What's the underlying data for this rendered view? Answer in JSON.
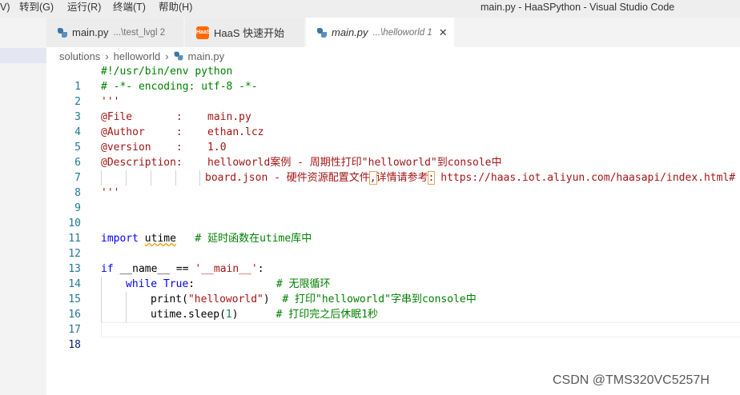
{
  "menubar": {
    "partial_left": "V)",
    "goto": "转到(G)",
    "run": "运行(R)",
    "terminal": "终端(T)",
    "help": "帮助(H)"
  },
  "window_title": "main.py - HaaSPython - Visual Studio Code",
  "tabs": [
    {
      "name": "main.py",
      "desc": "...\\test_lvgl 2",
      "icon": "python-icon"
    },
    {
      "name": "HaaS 快速开始",
      "desc": "",
      "icon": "haas-icon"
    },
    {
      "name": "main.py",
      "desc": "...\\helloworld 1",
      "icon": "python-icon",
      "active": true
    }
  ],
  "tab_close_glyph": "✕",
  "haas_icon_text": "HaaS",
  "breadcrumb": {
    "sep": "›",
    "items": [
      "solutions",
      "helloworld",
      "main.py"
    ]
  },
  "line_numbers": [
    "1",
    "2",
    "3",
    "4",
    "5",
    "6",
    "7",
    "8",
    "9",
    "10",
    "11",
    "12",
    "13",
    "14",
    "15",
    "16",
    "17",
    "18"
  ],
  "code": {
    "l1": "#!/usr/bin/env python",
    "l2": "# -*- encoding: utf-8 -*-",
    "l3": "'''",
    "l4": "@File       :    main.py",
    "l5": "@Author     :    ethan.lcz",
    "l6": "@version    :    1.0",
    "l7": "@Description:    helloworld案例 - 周期性打印\"helloworld\"到console中",
    "l8a": "board.json - 硬件资源配置文件",
    "l8b": ",",
    "l8c": "详情请参考",
    "l8d": ":",
    "l8e": " https://haas.iot.aliyun.com/haasapi/index.html#",
    "l9": "'''",
    "l12_kw": "import",
    "l12_mod": "utime",
    "l12_com": "# 延时函数在utime库中",
    "l14_kw": "if",
    "l14_a": " __name__ == ",
    "l14_str": "'__main__'",
    "l14_b": ":",
    "l15_kw": "while",
    "l15_true": "True",
    "l15_colon": ":",
    "l15_com": "# 无限循环",
    "l16_fn": "print(",
    "l16_str": "\"helloworld\"",
    "l16_close": ")",
    "l16_com": "# 打印\"helloworld\"字串到console中",
    "l17_fn": "utime.sleep(",
    "l17_num": "1",
    "l17_close": ")",
    "l17_com": "# 打印完之后休眠1秒"
  },
  "watermark": "CSDN @TMS320VC5257H",
  "colors": {
    "keyword": "#0000ff",
    "string": "#a31515",
    "comment": "#008000",
    "number": "#098658",
    "line_number": "#237893"
  }
}
